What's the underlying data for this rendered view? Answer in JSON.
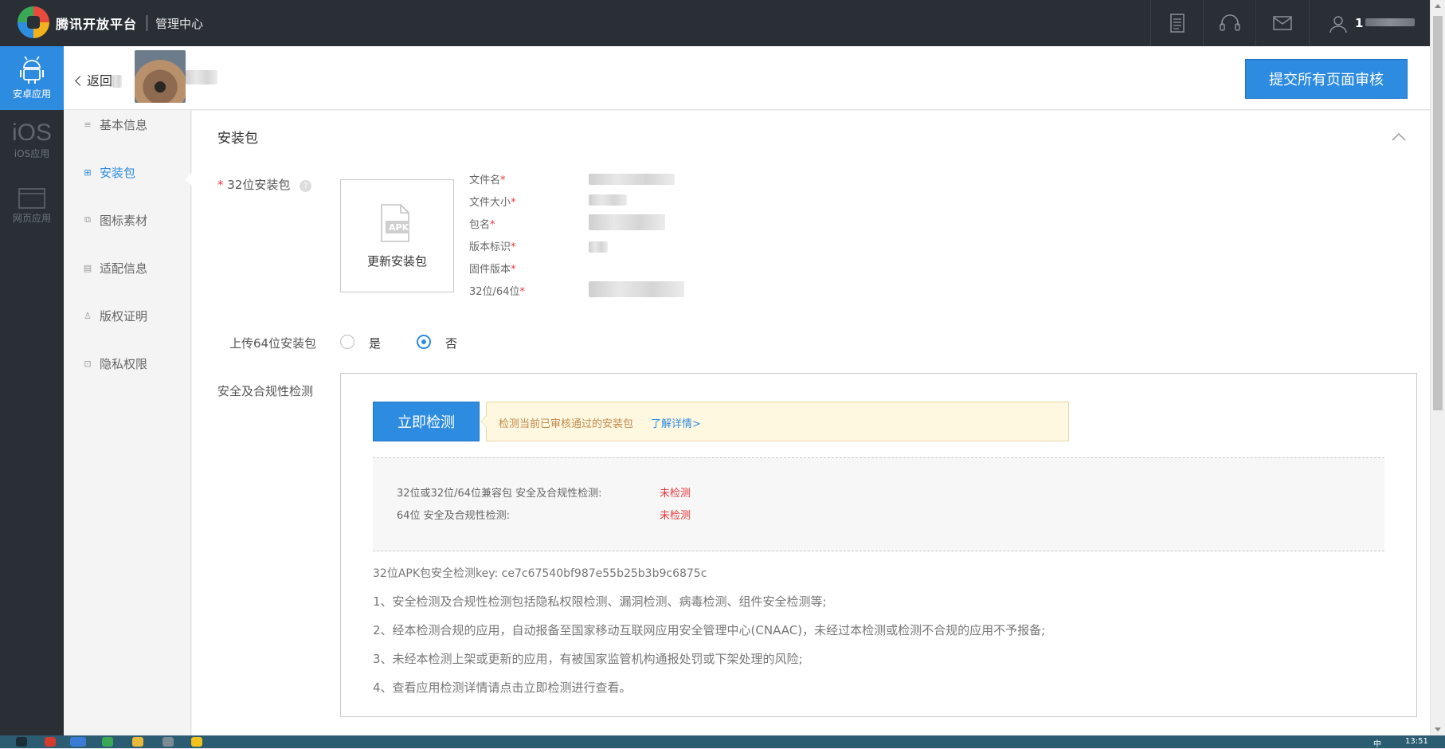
{
  "topbar": {
    "brand": "腾讯开放平台",
    "sub": "管理中心",
    "user_prefix": "1"
  },
  "leftbar": {
    "items": [
      {
        "label": "安卓应用",
        "icon": "android-icon",
        "active": true
      },
      {
        "label": "iOS应用",
        "icon_text": "iOS",
        "active": false
      },
      {
        "label": "网页应用",
        "icon": "browser-window-icon",
        "active": false
      }
    ]
  },
  "header": {
    "back_label": "返回",
    "submit_label": "提交所有页面审核"
  },
  "subnav": {
    "items": [
      {
        "label": "基本信息",
        "icon": "list-icon"
      },
      {
        "label": "安装包",
        "icon": "grid-icon"
      },
      {
        "label": "图标素材",
        "icon": "image-icon"
      },
      {
        "label": "适配信息",
        "icon": "doc-icon"
      },
      {
        "label": "版权证明",
        "icon": "badge-icon"
      },
      {
        "label": "隐私权限",
        "icon": "lock-icon"
      }
    ],
    "active_index": 1
  },
  "section": {
    "title": "安装包",
    "pkg32_label": "32位安装包",
    "apk_badge": "APK",
    "update_label": "更新安装包",
    "info_fields": [
      "文件名",
      "文件大小",
      "包名",
      "版本标识",
      "固件版本",
      "32位/64位"
    ],
    "upload64_label": "上传64位安装包",
    "radio_yes": "是",
    "radio_no": "否",
    "radio_selected": "否",
    "security_label": "安全及合规性检测"
  },
  "check": {
    "button": "立即检测",
    "tip": "检测当前已审核通过的安装包",
    "tip_link": "了解详情>",
    "rows": [
      {
        "label": "32位或32位/64位兼容包 安全及合规性检测:",
        "value": "未检测"
      },
      {
        "label": "64位 安全及合规性检测:",
        "value": "未检测"
      }
    ],
    "key_line": "32位APK包安全检测key: ce7c67540bf987e55b25b3b9c6875c",
    "notes": [
      "1、安全检测及合规性检测包括隐私权限检测、漏洞检测、病毒检测、组件安全检测等;",
      "2、经本检测合规的应用，自动报备至国家移动互联网应用安全管理中心(CNAAC)，未经过本检测或检测不合规的应用不予报备;",
      "3、未经本检测上架或更新的应用，有被国家监管机构通报处罚或下架处理的风险;",
      "4、查看应用检测详情请点击立即检测进行查看。"
    ]
  },
  "taskbar": {
    "clock": "13:51",
    "ime": "中"
  },
  "colors": {
    "accent": "#2d8be0",
    "topbar_bg": "#2a2f36",
    "error": "#e4393c",
    "tip_bg": "#fff8e1"
  }
}
